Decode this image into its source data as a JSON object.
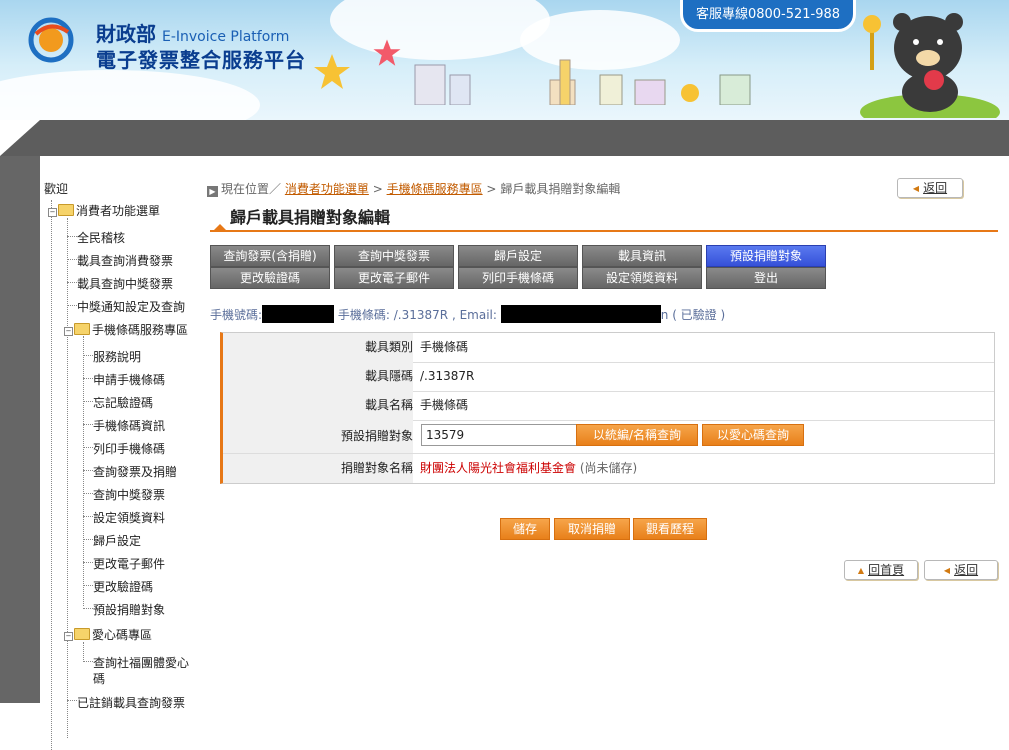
{
  "header": {
    "ministry": "財政部",
    "platform_en": "E-Invoice Platform",
    "platform_zh": "電子發票整合服務平台",
    "hotline": "客服專線0800-521-988"
  },
  "sidebar": {
    "welcome": "歡迎",
    "consumer_menu": "消費者功能選單",
    "items_l1": [
      "全民稽核",
      "載具查詢消費發票",
      "載具查詢中獎發票",
      "中獎通知設定及查詢"
    ],
    "mobile_zone": "手機條碼服務專區",
    "mobile_items": [
      "服務說明",
      "申請手機條碼",
      "忘記驗證碼",
      "手機條碼資訊",
      "列印手機條碼",
      "查詢發票及捐贈",
      "查詢中獎發票",
      "設定領獎資料",
      "歸戶設定",
      "更改電子郵件",
      "更改驗證碼",
      "預設捐贈對象"
    ],
    "love_zone": "愛心碼專區",
    "love_items_line1": "查詢社福團體愛心",
    "love_items_line2": "碼",
    "cut_item": "已註銷載具查詢發票"
  },
  "breadcrumb": {
    "prefix": "現在位置／",
    "link1": "消費者功能選單",
    "sep": ">",
    "link2": "手機條碼服務專區",
    "current": "歸戶載具捐贈對象編輯"
  },
  "back_label": "返回",
  "home_label": "回首頁",
  "page_title": "歸戶載具捐贈對象編輯",
  "tabs": {
    "row1": [
      "查詢發票(含捐贈)",
      "查詢中獎發票",
      "歸戶設定",
      "載具資訊",
      "預設捐贈對象"
    ],
    "row2": [
      "更改驗證碼",
      "更改電子郵件",
      "列印手機條碼",
      "設定領獎資料",
      "登出"
    ],
    "active": "預設捐贈對象"
  },
  "info": {
    "phone_label": "手機號碼:",
    "barcode_label": "手機條碼:",
    "barcode_value": "/.31387R",
    "email_label": "Email:",
    "email_tail": "n",
    "verified": "( 已驗證 )"
  },
  "form": {
    "carrier_type_label": "載具類別",
    "carrier_type_value": "手機條碼",
    "carrier_hidden_label": "載具隱碼",
    "carrier_hidden_value": "/.31387R",
    "carrier_name_label": "載具名稱",
    "carrier_name_value": "手機條碼",
    "default_target_label": "預設捐贈對象",
    "default_target_value": "13579",
    "search_by_id_button": "以統編/名稱查詢",
    "search_by_love_code_button": "以愛心碼查詢",
    "target_name_label": "捐贈對象名稱",
    "target_name_value": "財團法人陽光社會福利基金會",
    "target_name_status": "(尚未儲存)"
  },
  "actions": {
    "save": "儲存",
    "cancel_donation": "取消捐贈",
    "view_history": "觀看歷程"
  }
}
